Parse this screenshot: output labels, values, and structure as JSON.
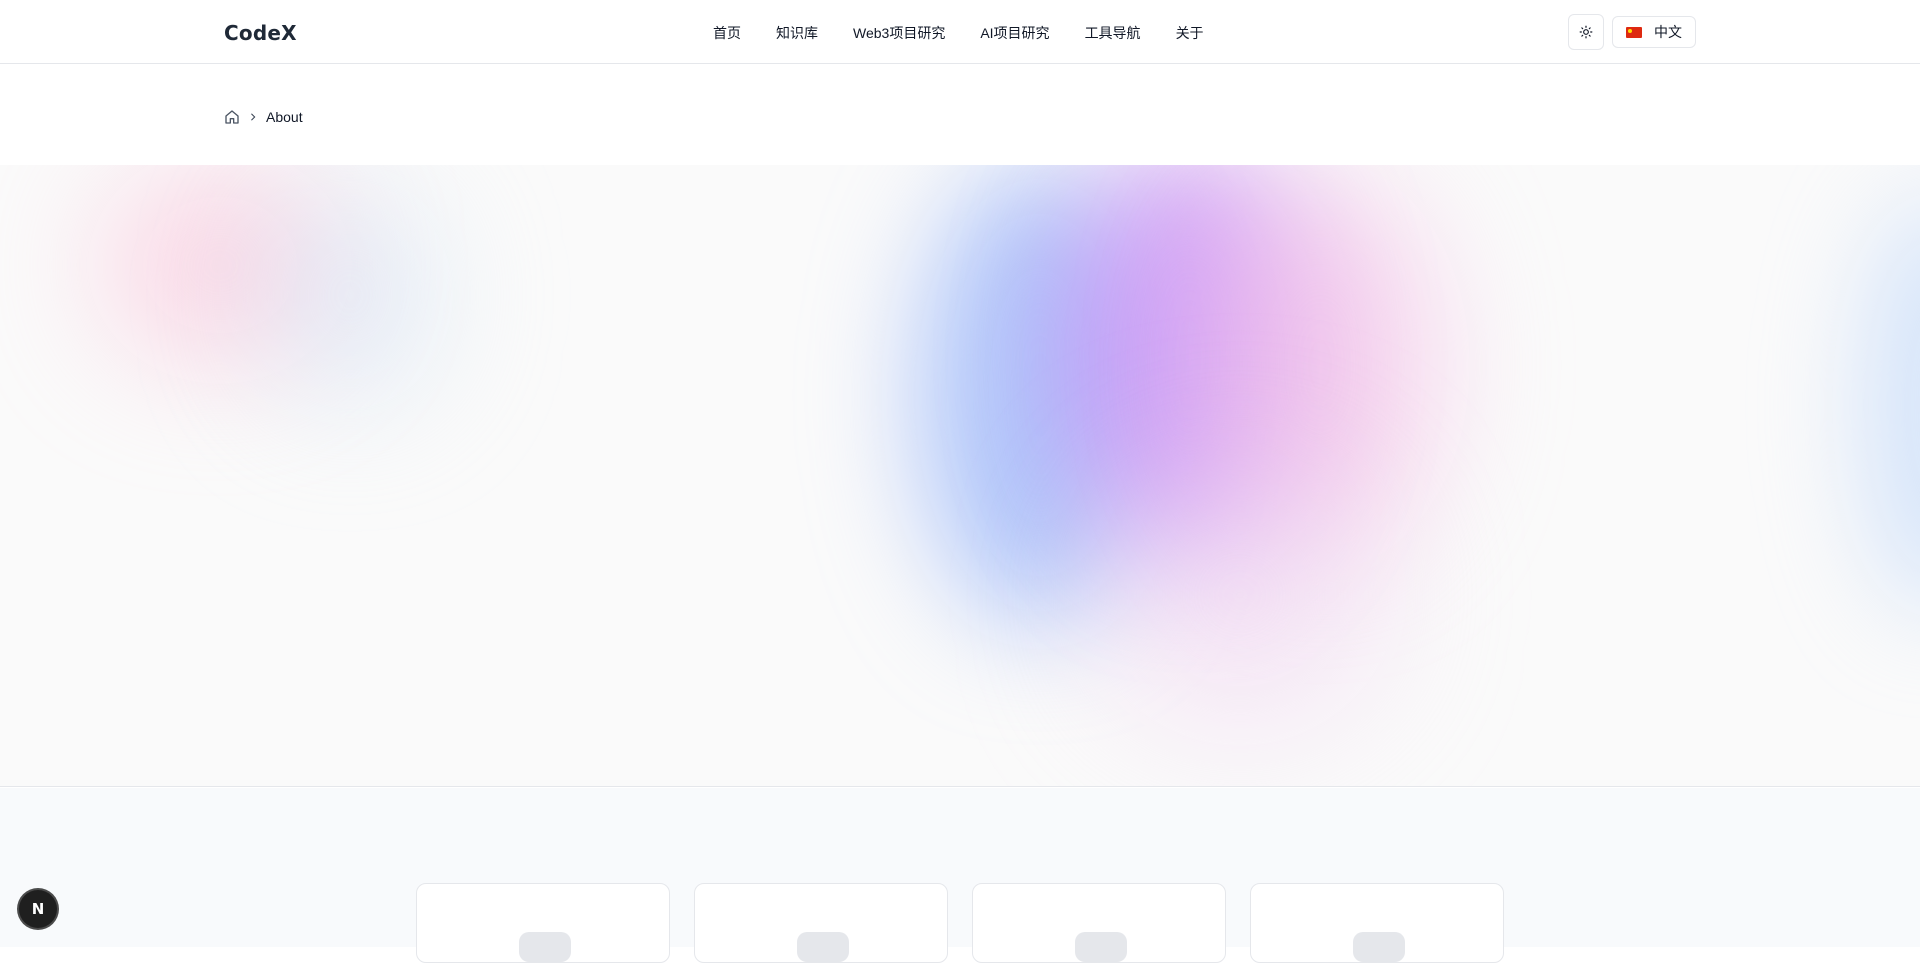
{
  "header": {
    "logo": "CodeX",
    "nav": [
      {
        "label": "首页"
      },
      {
        "label": "知识库"
      },
      {
        "label": "Web3项目研究"
      },
      {
        "label": "AI项目研究"
      },
      {
        "label": "工具导航"
      },
      {
        "label": "关于"
      }
    ],
    "theme_icon": "sun-icon",
    "language": {
      "flag": "china-flag-icon",
      "label": "中文"
    }
  },
  "breadcrumb": {
    "home_icon": "home-icon",
    "separator_icon": "chevron-right-icon",
    "current": "About"
  },
  "floating_badge": {
    "label": "N"
  },
  "colors": {
    "hero_blue": "#96b4fa",
    "hero_purple": "#c88cf5",
    "hero_pink": "#f5bee6",
    "accent_dark": "#1f1f1f"
  }
}
